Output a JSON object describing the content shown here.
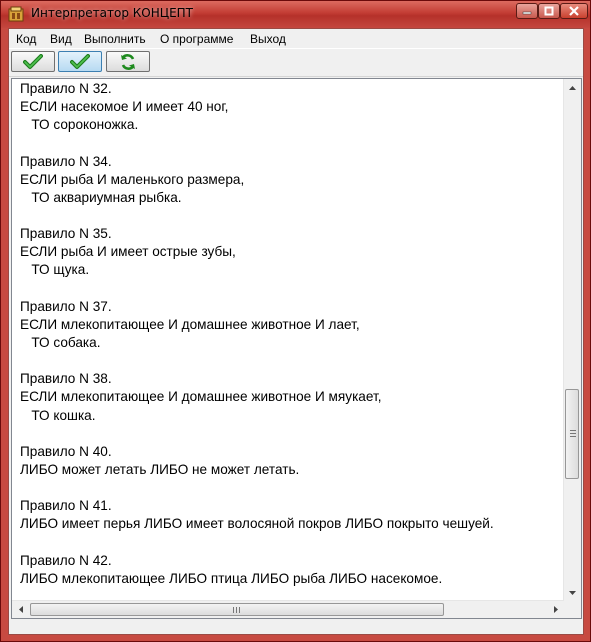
{
  "window": {
    "title": "Интерпретатор КОНЦЕПТ",
    "accent_color": "#c23c33"
  },
  "menu": {
    "items": [
      {
        "label": "Код"
      },
      {
        "label": "Вид"
      },
      {
        "label": "Выполнить"
      },
      {
        "label": "О программе"
      },
      {
        "label": "Выход"
      }
    ]
  },
  "toolbar": {
    "buttons": [
      {
        "icon": "checkmark-icon",
        "state": "normal"
      },
      {
        "icon": "checkmark-icon",
        "state": "pressed"
      },
      {
        "icon": "refresh-icon",
        "state": "normal"
      }
    ]
  },
  "editor": {
    "lines": [
      "Правило N 32.",
      "ЕСЛИ насекомое И имеет 40 ног,",
      "   ТО сороконожка.",
      "",
      "Правило N 34.",
      "ЕСЛИ рыба И маленького размера,",
      "   ТО аквариумная рыбка.",
      "",
      "Правило N 35.",
      "ЕСЛИ рыба И имеет острые зубы,",
      "   ТО щука.",
      "",
      "Правило N 37.",
      "ЕСЛИ млекопитающее И домашнее животное И лает,",
      "   ТО собака.",
      "",
      "Правило N 38.",
      "ЕСЛИ млекопитающее И домашнее животное И мяукает,",
      "   ТО кошка.",
      "",
      "Правило N 40.",
      "ЛИБО может летать ЛИБО не может летать.",
      "",
      "Правило N 41.",
      "ЛИБО имеет перья ЛИБО имеет волосяной покров ЛИБО покрыто чешуей.",
      "",
      "Правило N 42.",
      "ЛИБО млекопитающее ЛИБО птица ЛИБО рыба ЛИБО насекомое."
    ]
  }
}
